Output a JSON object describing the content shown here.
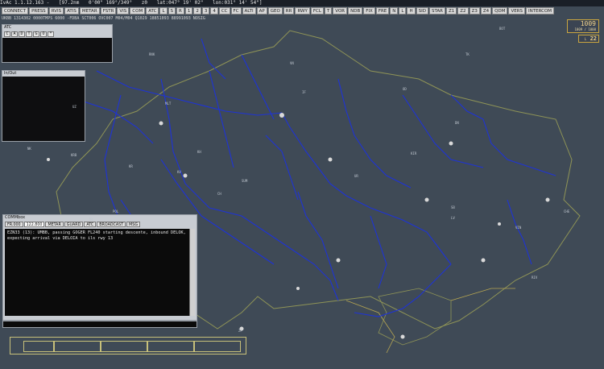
{
  "titlebar": {
    "app": "IvAc 1.1.12.163 -",
    "range": "[97.2nm",
    "bearing": "0'00\"  169°/349°",
    "zoom": "z0",
    "lat": "lat:047° 19' 02\"",
    "lon": "lon:031° 14' 54\"]"
  },
  "toolbar": [
    "CONNECT",
    "PRESS",
    "RVIS",
    "ATIS",
    "METAR",
    "FSTR",
    "VIS",
    "COM",
    "ATC",
    "L",
    "S",
    "R",
    "1",
    "2",
    "3",
    "4",
    "CC",
    "FC",
    "ALTI",
    "AP",
    "GEO",
    "RR",
    "RWY",
    "FCL",
    "T",
    "VOR",
    "NDB",
    "FIX",
    "FRE",
    "N",
    "L",
    "H",
    "SID",
    "STAR",
    "Z1",
    "Z2",
    "Z3",
    "Z4",
    "QDM",
    "VERS",
    "INTERCOM"
  ],
  "statusline": "UKBB 1314302 0000TMPS 6000 -FDBA SCT006 OVC007 M04/M04 Q1029 18851093 88991093 NOSIG",
  "atc_panel": {
    "title": "ATC",
    "tabs": [
      "C",
      "A",
      "D",
      "T",
      "G",
      "O",
      "*"
    ]
  },
  "inout_panel": {
    "title": "In/Out"
  },
  "comm_panel": {
    "title": "COMMbox",
    "tabs": [
      "FR.000",
      "122.800",
      "METAR",
      "GUARD",
      "ATC",
      "BROADCAST",
      "MSG"
    ],
    "messages": [
      "EZN33 (13): UMBB, passing GOGER FL240 starting descente, inbound DELOK,",
      "expecting arrival via DELOIA to ils rwy 13"
    ]
  },
  "qnh": {
    "value": "1009",
    "sub": "1009 / 1000"
  },
  "transition": {
    "prefix": "L",
    "value": "22"
  },
  "colors": {
    "background": "#3f4a56",
    "rivers": "#1e33d6",
    "border": "#8f9456",
    "sector": "#b8a752"
  },
  "map_labels": [
    "RNK",
    "KRB",
    "MLT",
    "BOT",
    "TK",
    "UR",
    "LV",
    "ZP",
    "OD",
    "KV",
    "DN",
    "KH",
    "CH",
    "SB",
    "POL",
    "NK",
    "KR",
    "VN",
    "IF",
    "UZ",
    "TR",
    "SUM",
    "VIN",
    "KIR",
    "RIV",
    "CHE"
  ]
}
